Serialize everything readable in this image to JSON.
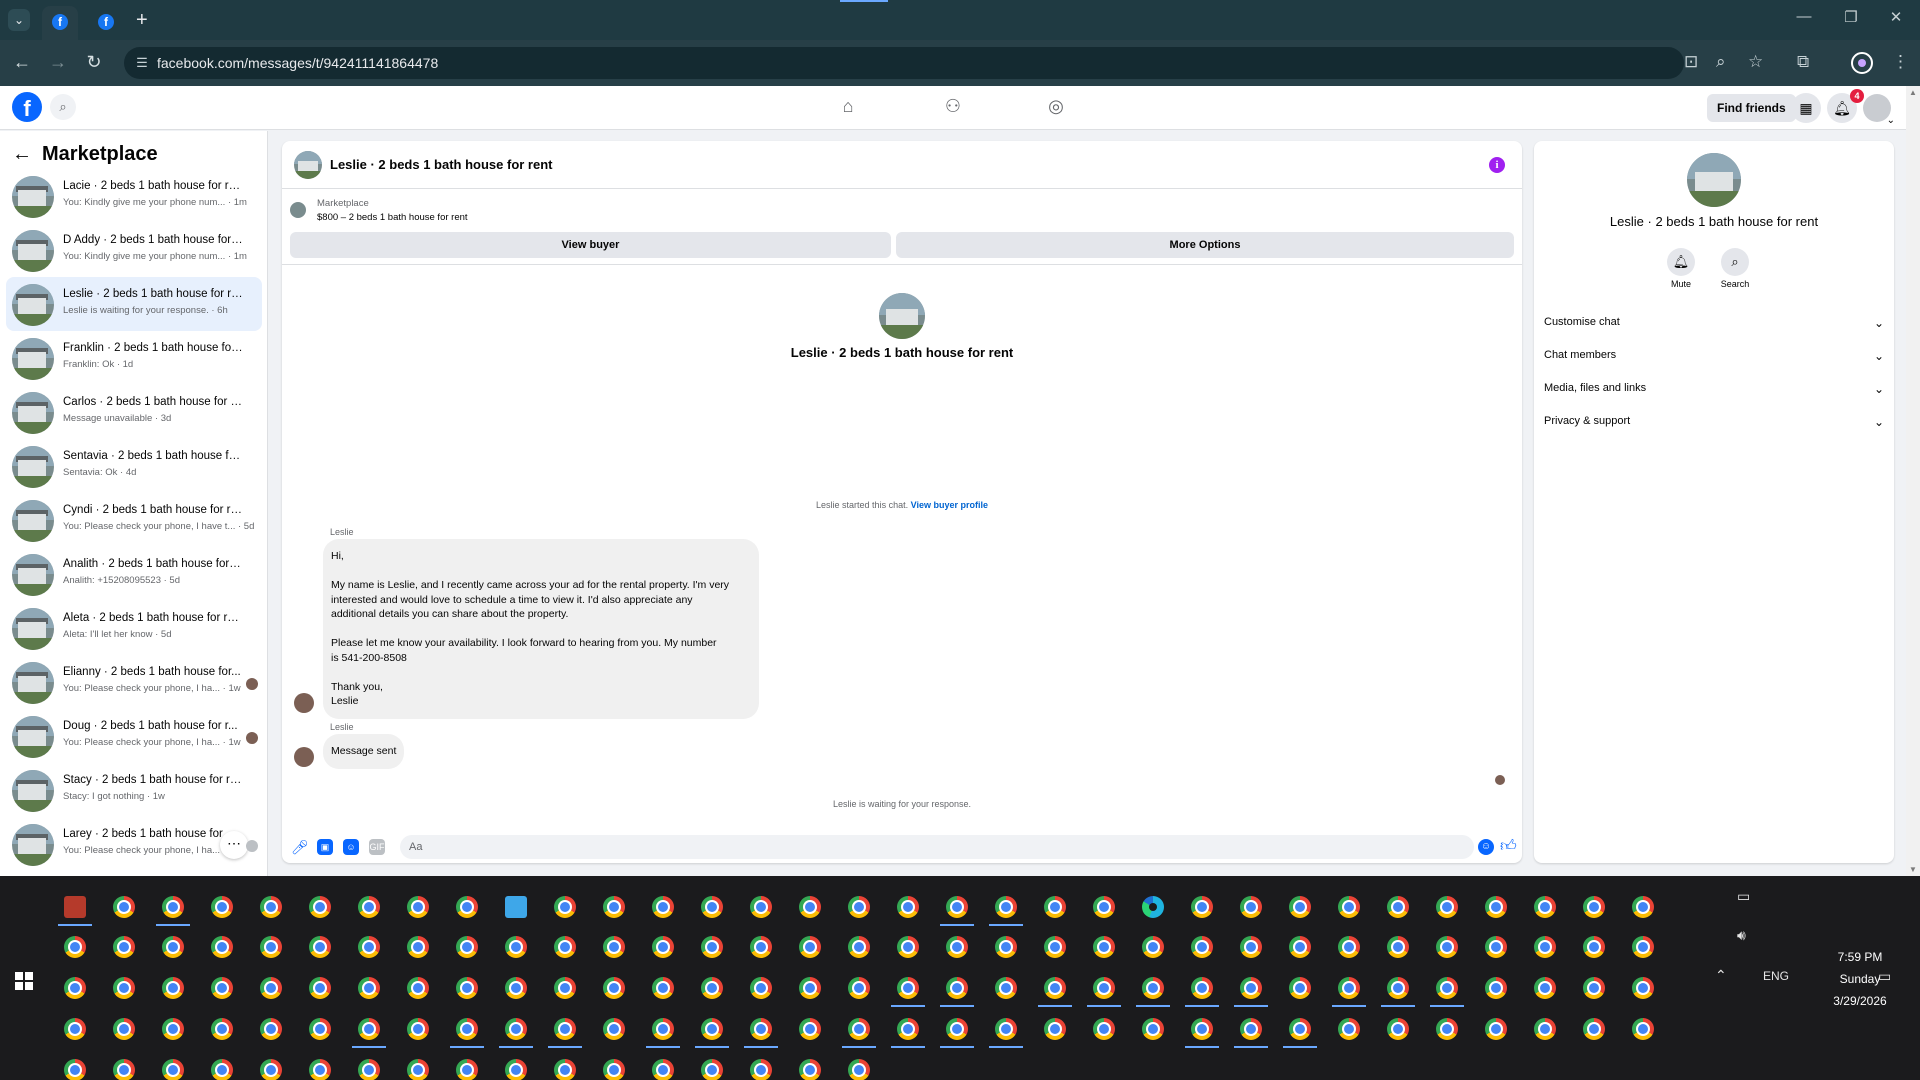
{
  "browser": {
    "url": "facebook.com/messages/t/942411141864478",
    "tabs": [
      {
        "favicon": "facebook-icon",
        "active": true
      },
      {
        "favicon": "facebook-icon",
        "active": false
      }
    ],
    "new_tab_symbol": "+"
  },
  "fb_header": {
    "find_friends_label": "Find friends",
    "notification_count": "4"
  },
  "left_panel": {
    "title": "Marketplace",
    "conversations": [
      {
        "name": "Lacie · 2 beds 1 bath house for rent",
        "preview": "You: Kindly give me your phone num... · 1m"
      },
      {
        "name": "D Addy · 2 beds 1 bath house for r...",
        "preview": "You: Kindly give me your phone num... · 1m"
      },
      {
        "name": "Leslie · 2 beds 1 bath house for rent",
        "preview": "Leslie is waiting for your response. · 6h"
      },
      {
        "name": "Franklin · 2 beds 1 bath house for r...",
        "preview": "Franklin: Ok · 1d"
      },
      {
        "name": "Carlos · 2 beds 1 bath house for rent",
        "preview": "Message unavailable · 3d"
      },
      {
        "name": "Sentavia · 2 beds 1 bath house for ...",
        "preview": "Sentavia: Ok · 4d"
      },
      {
        "name": "Cyndi · 2 beds 1 bath house for rent",
        "preview": "You: Please check your phone, I have t... · 5d"
      },
      {
        "name": "Analith · 2 beds 1 bath house for r...",
        "preview": "Analith: +15208095523 · 5d"
      },
      {
        "name": "Aleta · 2 beds 1 bath house for rent",
        "preview": "Aleta: I'll let her know · 5d"
      },
      {
        "name": "Elianny · 2 beds 1 bath house for...",
        "preview": "You: Please check your phone, I ha... · 1w"
      },
      {
        "name": "Doug · 2 beds 1 bath house for r...",
        "preview": "You: Please check your phone, I ha... · 1w"
      },
      {
        "name": "Stacy · 2 beds 1 bath house for rent",
        "preview": "Stacy: I got nothing · 1w"
      },
      {
        "name": "Larey · 2 beds 1 bath house for ...",
        "preview": "You: Please check your phone, I ha... · 1w"
      }
    ]
  },
  "chat": {
    "title": "Leslie · 2 beds 1 bath house for rent",
    "marketplace_label": "Marketplace",
    "listing": "$800 – 2 beds 1 bath house for rent",
    "view_buyer_label": "View buyer",
    "more_options_label": "More Options",
    "intro_title": "Leslie · 2 beds 1 bath house for rent",
    "started_text": "Leslie started this chat.",
    "view_profile_link": "View buyer profile",
    "messages": [
      {
        "sender": "Leslie",
        "lines": [
          "Hi,",
          "",
          "My name is Leslie, and I recently came across your ad for the rental property. I'm very",
          "interested and would love to schedule a time to view it. I'd also appreciate any",
          "additional details you can share about the property.",
          "",
          "Please let me know your availability. I look forward to hearing from you. My number",
          "is 541-200-8508",
          "",
          "Thank you,",
          "Leslie"
        ]
      },
      {
        "sender": "Leslie",
        "lines": [
          "Message sent"
        ]
      }
    ],
    "waiting_text": "Leslie is waiting for your response.",
    "composer_placeholder": "Aa"
  },
  "right_panel": {
    "title": "Leslie · 2 beds 1 bath house for rent",
    "mute_label": "Mute",
    "search_label": "Search",
    "sections": [
      "Customise chat",
      "Chat members",
      "Media, files and links",
      "Privacy & support"
    ]
  },
  "taskbar": {
    "language": "ENG",
    "time": "7:59 PM",
    "day": "Sunday",
    "date": "3/29/2026"
  },
  "colors": {
    "facebook_blue": "#0866ff",
    "browser_frame": "#273f47",
    "selected_conversation": "#e7f0fd",
    "info_icon": "#a020f0",
    "notification_badge": "#e41e3f",
    "link": "#0064d1"
  }
}
